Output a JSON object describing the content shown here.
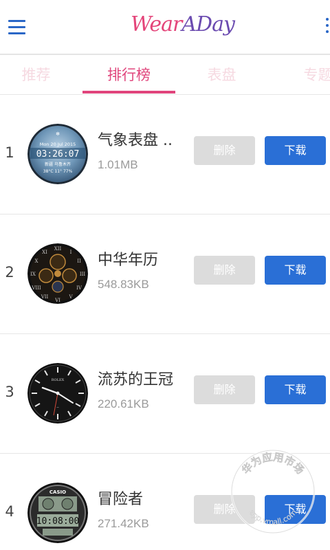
{
  "header": {
    "logo_text_a": "Wear",
    "logo_text_b": "ADay",
    "menu_icon": "hamburger-menu-icon",
    "more_icon": "vertical-dots-icon"
  },
  "tabs": [
    {
      "label": "推荐",
      "active": false
    },
    {
      "label": "排行榜",
      "active": true
    },
    {
      "label": "表盘",
      "active": false
    },
    {
      "label": "专题",
      "active": false
    }
  ],
  "items": [
    {
      "rank": "1",
      "name": "气象表盘 ..",
      "size": "1.01MB",
      "delete_label": "删除",
      "download_label": "下载",
      "face": {
        "date": "Mon 20 Jul 2015",
        "time": "03:26:07",
        "line3": "新疆 乌鲁木齐",
        "line4": "38°C  11°  77%"
      }
    },
    {
      "rank": "2",
      "name": "中华年历",
      "size": "548.83KB",
      "delete_label": "删除",
      "download_label": "下载"
    },
    {
      "rank": "3",
      "name": "流苏的王冠",
      "size": "220.61KB",
      "delete_label": "删除",
      "download_label": "下载",
      "face": {
        "brand": "ROLEX"
      }
    },
    {
      "rank": "4",
      "name": "冒险者",
      "size": "271.42KB",
      "delete_label": "删除",
      "download_label": "下载",
      "face": {
        "brand": "CASIO",
        "time": "10:08:00"
      }
    }
  ],
  "watermark": {
    "text": "华为应用市场",
    "url": "app.vmall.com"
  },
  "colors": {
    "accent_pink": "#e0457c",
    "download_blue": "#2a6fd6",
    "delete_gray": "#dcdcdc",
    "menu_blue": "#2a67c7"
  }
}
